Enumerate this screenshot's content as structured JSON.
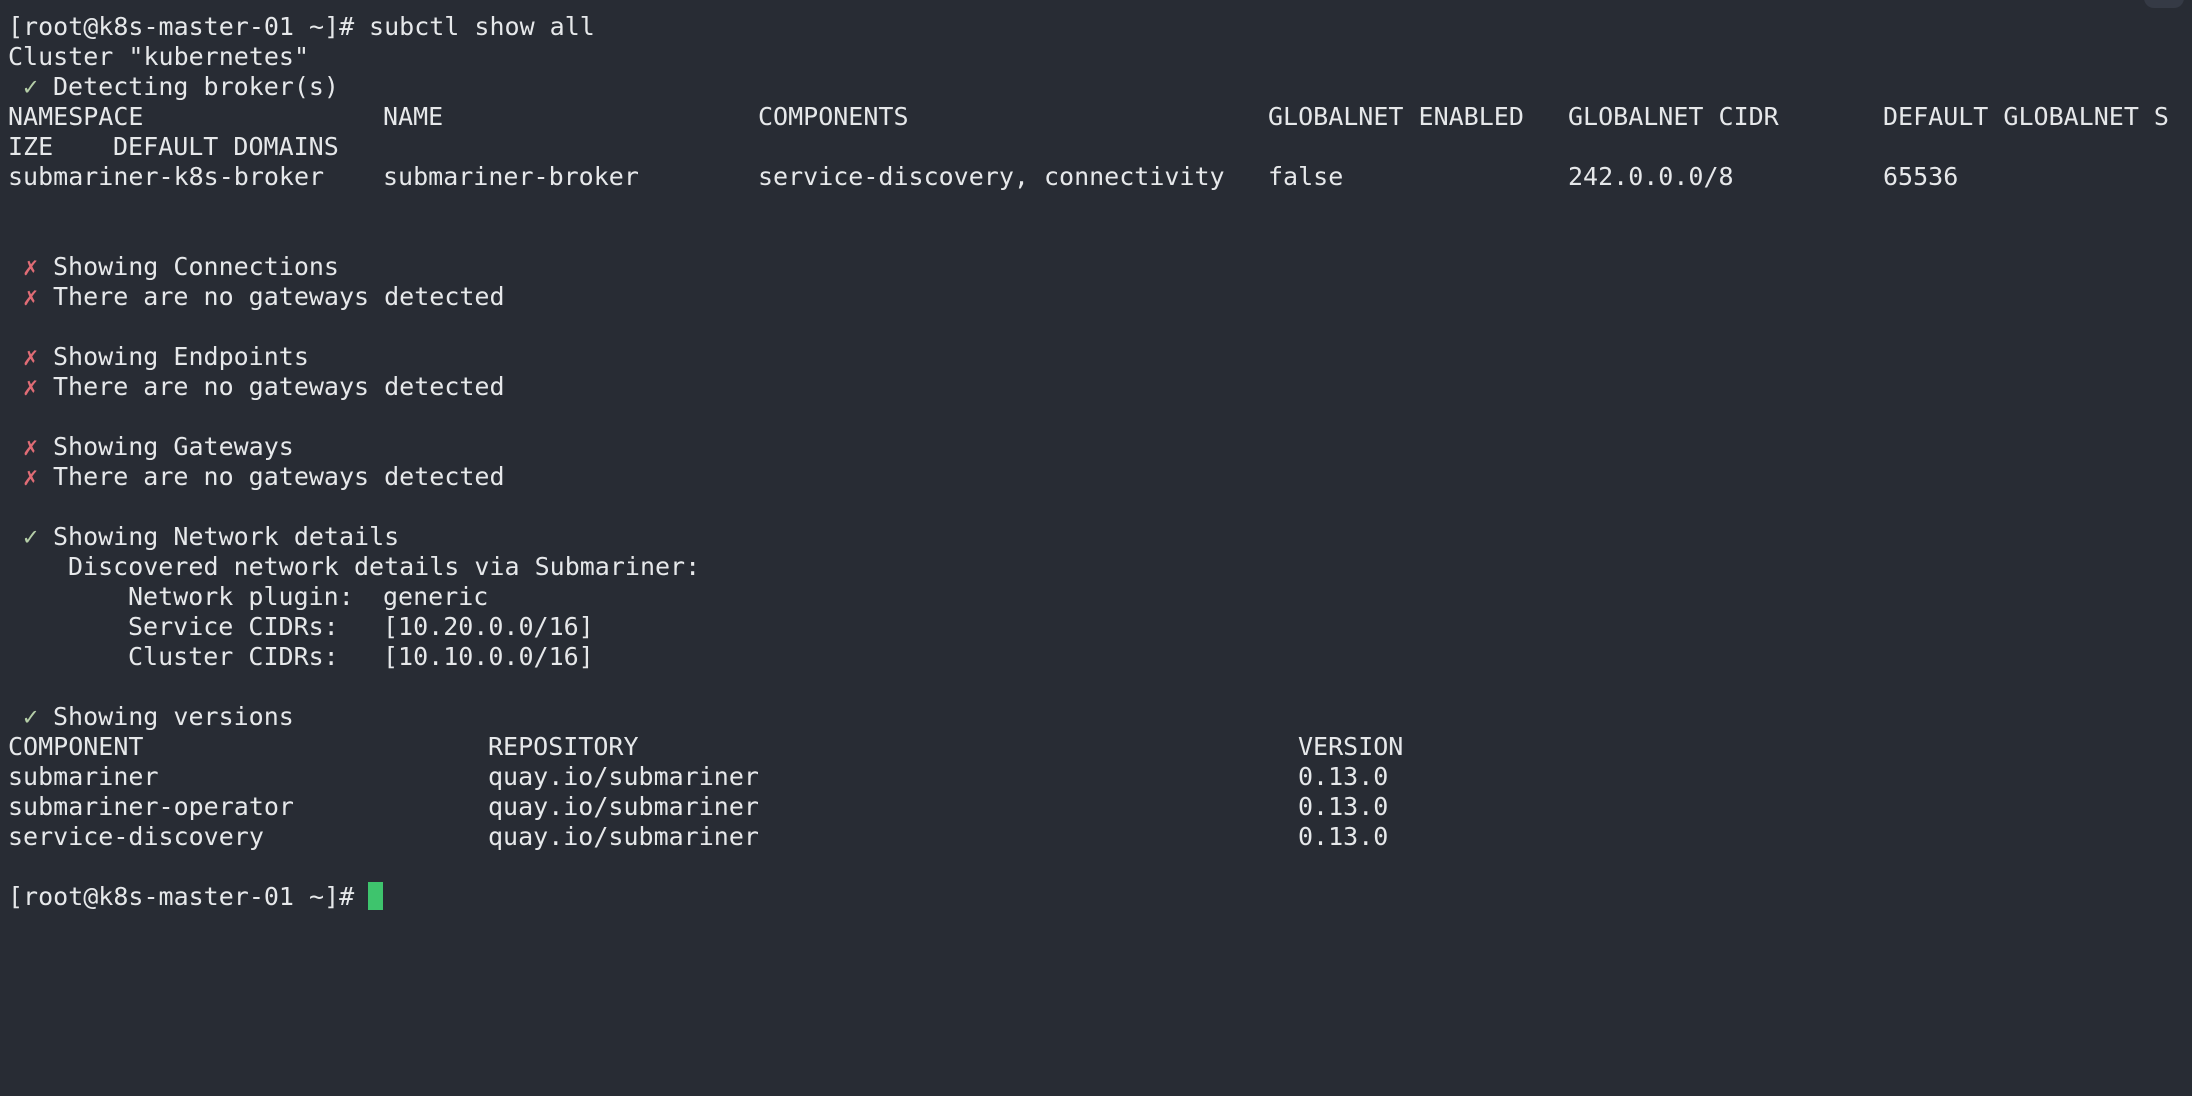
{
  "prompt": "[root@k8s-master-01 ~]#",
  "command": " subctl show all",
  "cluster_line": "Cluster \"kubernetes\"",
  "glyphs": {
    "check": "✓",
    "cross": "✗"
  },
  "broker": {
    "title": "Detecting broker(s)",
    "headers": [
      "NAMESPACE",
      "NAME",
      "COMPONENTS",
      "GLOBALNET ENABLED",
      "GLOBALNET CIDR",
      "DEFAULT GLOBALNET S"
    ],
    "header_wrap": [
      "IZE",
      "DEFAULT DOMAINS"
    ],
    "row": [
      "submariner-k8s-broker",
      "submariner-broker",
      "service-discovery, connectivity",
      "false",
      "242.0.0.0/8",
      "65536"
    ]
  },
  "sections": {
    "connections": {
      "title": "Showing Connections",
      "message": "There are no gateways detected"
    },
    "endpoints": {
      "title": "Showing Endpoints",
      "message": "There are no gateways detected"
    },
    "gateways": {
      "title": "Showing Gateways",
      "message": "There are no gateways detected"
    },
    "network": {
      "title": "Showing Network details",
      "discovered": "Discovered network details via Submariner:",
      "plugin_label": "Network plugin:",
      "plugin_value": "generic",
      "service_label": "Service CIDRs:",
      "service_value": "[10.20.0.0/16]",
      "cluster_label": "Cluster CIDRs:",
      "cluster_value": "[10.10.0.0/16]"
    },
    "versions": {
      "title": "Showing versions",
      "headers": [
        "COMPONENT",
        "REPOSITORY",
        "VERSION"
      ],
      "rows": [
        [
          "submariner",
          "quay.io/submariner",
          "0.13.0"
        ],
        [
          "submariner-operator",
          "quay.io/submariner",
          "0.13.0"
        ],
        [
          "service-discovery",
          "quay.io/submariner",
          "0.13.0"
        ]
      ]
    }
  },
  "colors": {
    "background": "#282c34",
    "text": "#e6e8ea",
    "check": "#b5cea8",
    "cross": "#e06c75",
    "cursor": "#3ec46d"
  }
}
